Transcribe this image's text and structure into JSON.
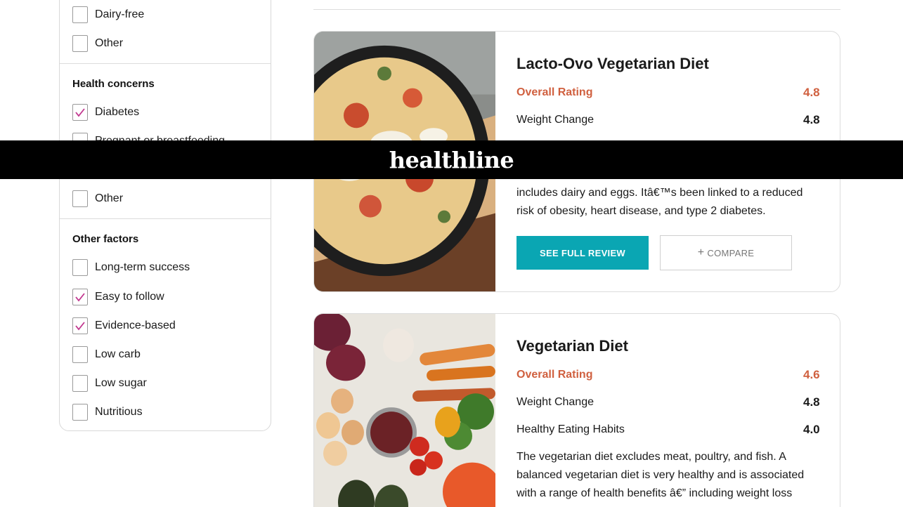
{
  "header": {
    "logo": "healthline"
  },
  "filters": {
    "top_options": [
      {
        "label": "Dairy-free",
        "checked": false
      },
      {
        "label": "Other",
        "checked": false
      }
    ],
    "health_concerns": {
      "title": "Health concerns",
      "options": [
        {
          "label": "Diabetes",
          "checked": true
        },
        {
          "label": "Pregnant or breastfeeding",
          "checked": false
        },
        {
          "label": "Other",
          "checked": false
        }
      ]
    },
    "other_factors": {
      "title": "Other factors",
      "options": [
        {
          "label": "Long-term success",
          "checked": false
        },
        {
          "label": "Easy to follow",
          "checked": true
        },
        {
          "label": "Evidence-based",
          "checked": true
        },
        {
          "label": "Low carb",
          "checked": false
        },
        {
          "label": "Low sugar",
          "checked": false
        },
        {
          "label": "Nutritious",
          "checked": false
        }
      ]
    }
  },
  "diets": [
    {
      "title": "Lacto-Ovo Vegetarian Diet",
      "ratings": [
        {
          "label": "Overall Rating",
          "value": "4.8"
        },
        {
          "label": "Weight Change",
          "value": "4.8"
        }
      ],
      "description_lines": [
        "includes dairy and eggs. Itâ€™s been linked to a reduced",
        "risk of obesity, heart disease, and type 2 diabetes."
      ],
      "review_button": "SEE FULL REVIEW",
      "compare_button": "COMPARE",
      "compare_icon": "plus-icon"
    },
    {
      "title": "Vegetarian Diet",
      "ratings": [
        {
          "label": "Overall Rating",
          "value": "4.6"
        },
        {
          "label": "Weight Change",
          "value": "4.8"
        },
        {
          "label": "Healthy Eating Habits",
          "value": "4.0"
        }
      ],
      "description_lines": [
        "The vegetarian diet excludes meat, poultry, and fish. A",
        "balanced vegetarian diet is very healthy and is associated",
        "with a range of health benefits â€” including weight loss"
      ]
    }
  ],
  "colors": {
    "accent_teal": "#0aa6b3",
    "rating_orange": "#d0603f",
    "banner": "#000000"
  }
}
